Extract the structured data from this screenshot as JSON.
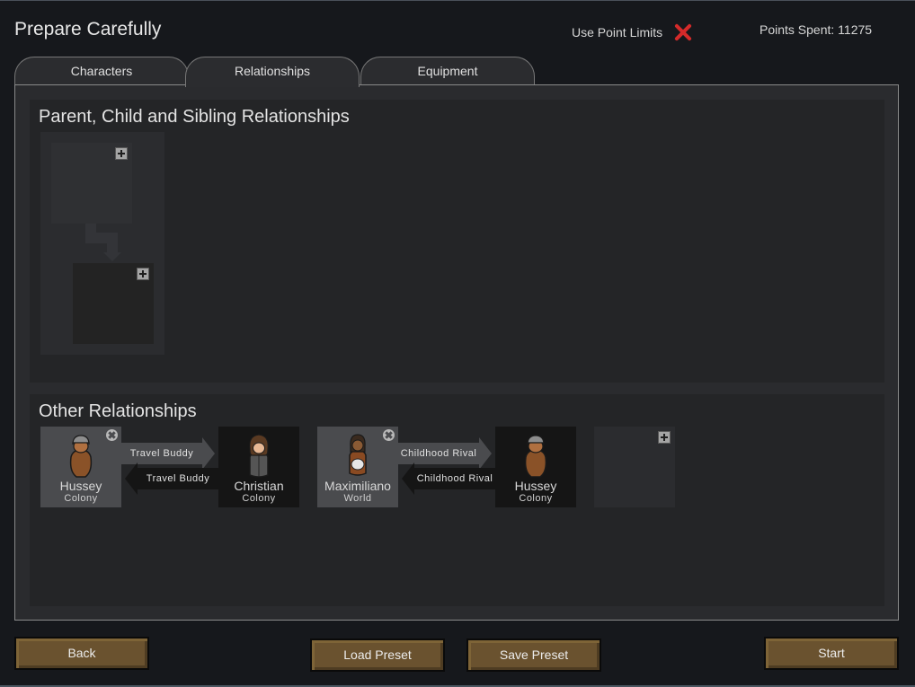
{
  "window": {
    "title": "Prepare Carefully",
    "use_point_limits_label": "Use Point Limits",
    "use_point_limits_icon": "red-x-icon",
    "use_point_limits_enabled": false,
    "points_spent_label": "Points Spent: 11275"
  },
  "tabs": [
    {
      "label": "Characters",
      "active": false
    },
    {
      "label": "Relationships",
      "active": true
    },
    {
      "label": "Equipment",
      "active": false
    }
  ],
  "parent_section": {
    "title": "Parent, Child and Sibling Relationships",
    "add_parent_icon": "plus-icon",
    "add_child_icon": "plus-icon"
  },
  "other_section": {
    "title": "Other Relationships",
    "relationships": [
      {
        "source": {
          "name": "Hussey",
          "origin": "Colony",
          "portrait": "pawn-portrait-gray-helmet-brown-coat"
        },
        "target": {
          "name": "Christian",
          "origin": "Colony",
          "portrait": "pawn-portrait-brown-hair-gray-vest"
        },
        "forward_label": "Travel Buddy",
        "reverse_label": "Travel Buddy"
      },
      {
        "source": {
          "name": "Maximiliano",
          "origin": "World",
          "portrait": "pawn-portrait-dark-hair-orange-shirt"
        },
        "target": {
          "name": "Hussey",
          "origin": "Colony",
          "portrait": "pawn-portrait-gray-helmet-brown-coat"
        },
        "forward_label": "Childhood Rival",
        "reverse_label": "Childhood Rival"
      }
    ],
    "add_relationship_icon": "plus-icon"
  },
  "footer": {
    "back_label": "Back",
    "load_preset_label": "Load Preset",
    "save_preset_label": "Save Preset",
    "start_label": "Start"
  },
  "colors": {
    "background": "#16181c",
    "panel": "#2a2b2e",
    "section": "#242527",
    "button": "#6a522f",
    "disabled_x": "#d42a2a"
  }
}
